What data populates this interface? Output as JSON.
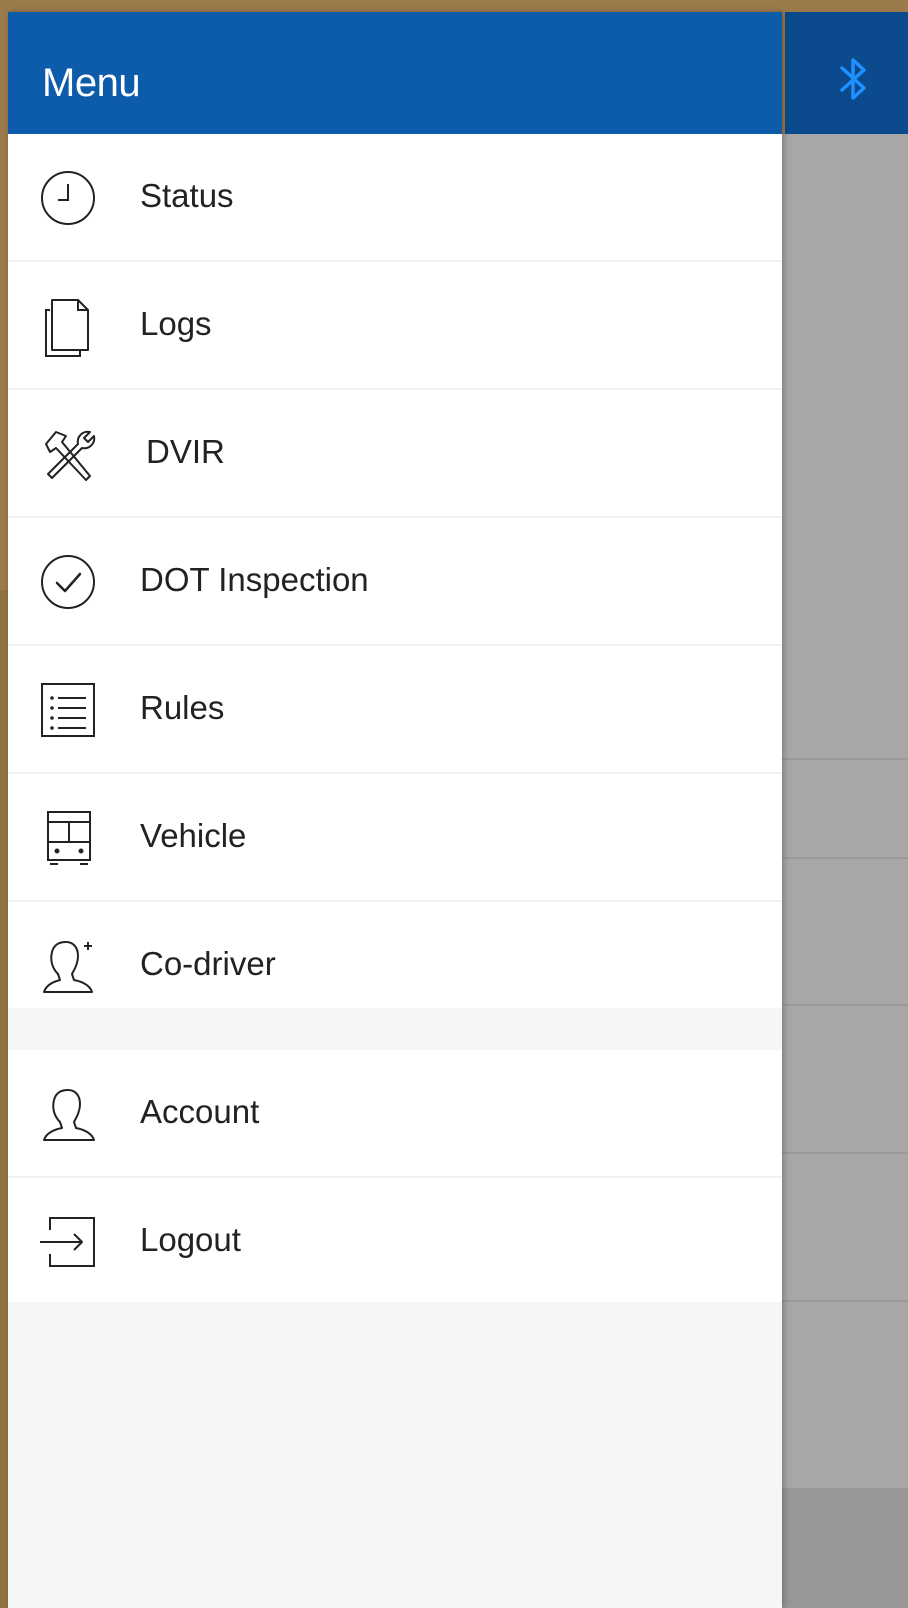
{
  "drawer": {
    "title": "Menu"
  },
  "header_right": {
    "icon": "bluetooth-icon",
    "color": "#1e90ff"
  },
  "menu": {
    "primary": [
      {
        "label": "Status",
        "icon": "clock-icon"
      },
      {
        "label": "Logs",
        "icon": "documents-icon"
      },
      {
        "label": "DVIR",
        "icon": "tools-icon"
      },
      {
        "label": "DOT Inspection",
        "icon": "check-circle-icon"
      },
      {
        "label": "Rules",
        "icon": "list-icon"
      },
      {
        "label": "Vehicle",
        "icon": "bus-icon"
      },
      {
        "label": "Co-driver",
        "icon": "add-user-icon"
      }
    ],
    "secondary": [
      {
        "label": "Account",
        "icon": "user-icon"
      },
      {
        "label": "Logout",
        "icon": "logout-icon"
      }
    ]
  },
  "colors": {
    "header": "#0c5cab",
    "drawer_background": "#f6f6f6",
    "item_background": "#ffffff",
    "text": "#222222"
  }
}
